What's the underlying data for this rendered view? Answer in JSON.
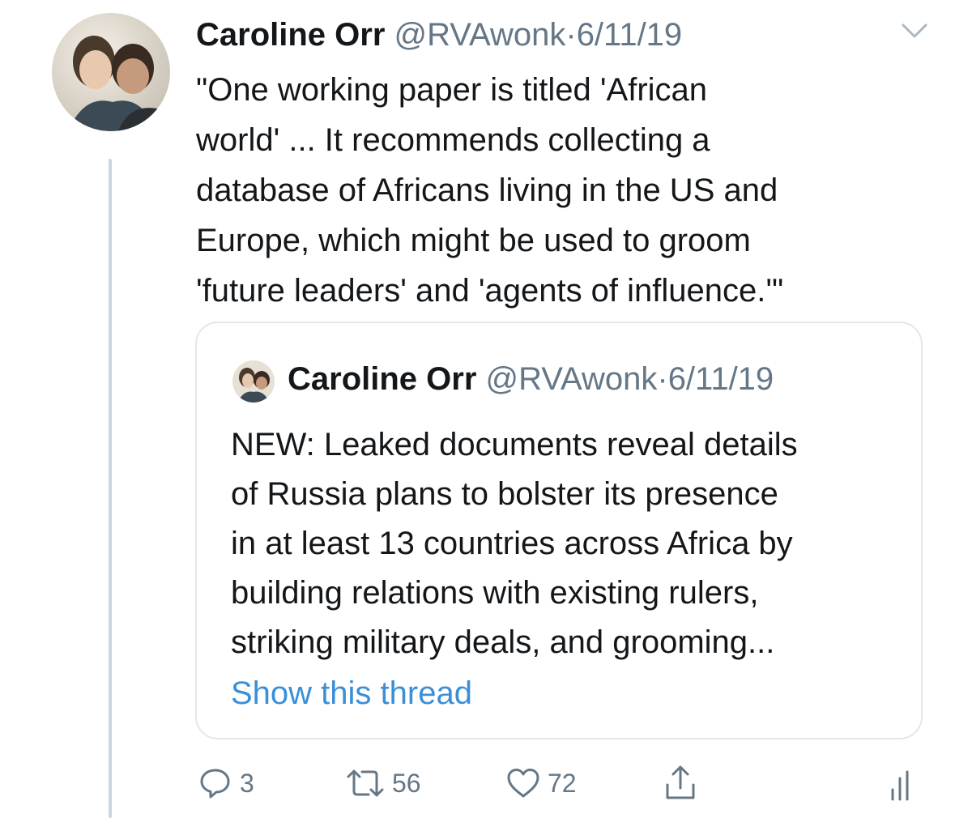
{
  "tweet": {
    "author_name": "Caroline Orr",
    "handle": "@RVAwonk",
    "separator": "·",
    "date": "6/11/19",
    "text_lines": [
      "\"One working paper is titled 'African",
      "world' ... It recommends collecting a",
      "database of Africans living in the US and",
      "Europe, which might be used to groom",
      "'future leaders' and 'agents of influence.'\""
    ]
  },
  "quoted_tweet": {
    "author_name": "Caroline Orr",
    "handle": "@RVAwonk",
    "separator": "·",
    "date": "6/11/19",
    "text_lines": [
      "NEW: Leaked documents reveal details",
      "of Russia plans to bolster its presence",
      "in at least 13 countries across Africa by",
      "building relations with existing rulers,",
      "striking military deals, and grooming..."
    ],
    "show_thread_label": "Show this thread"
  },
  "actions": {
    "reply_count": "3",
    "retweet_count": "56",
    "like_count": "72"
  },
  "icons": {
    "menu": "chevron-down-icon",
    "reply": "reply-icon",
    "retweet": "retweet-icon",
    "like": "heart-icon",
    "share": "share-icon",
    "analytics": "analytics-icon"
  },
  "colors": {
    "link": "#3b8fd9",
    "muted": "#657786",
    "border": "#e1e8ed",
    "thread_line": "#ccd6dd"
  }
}
